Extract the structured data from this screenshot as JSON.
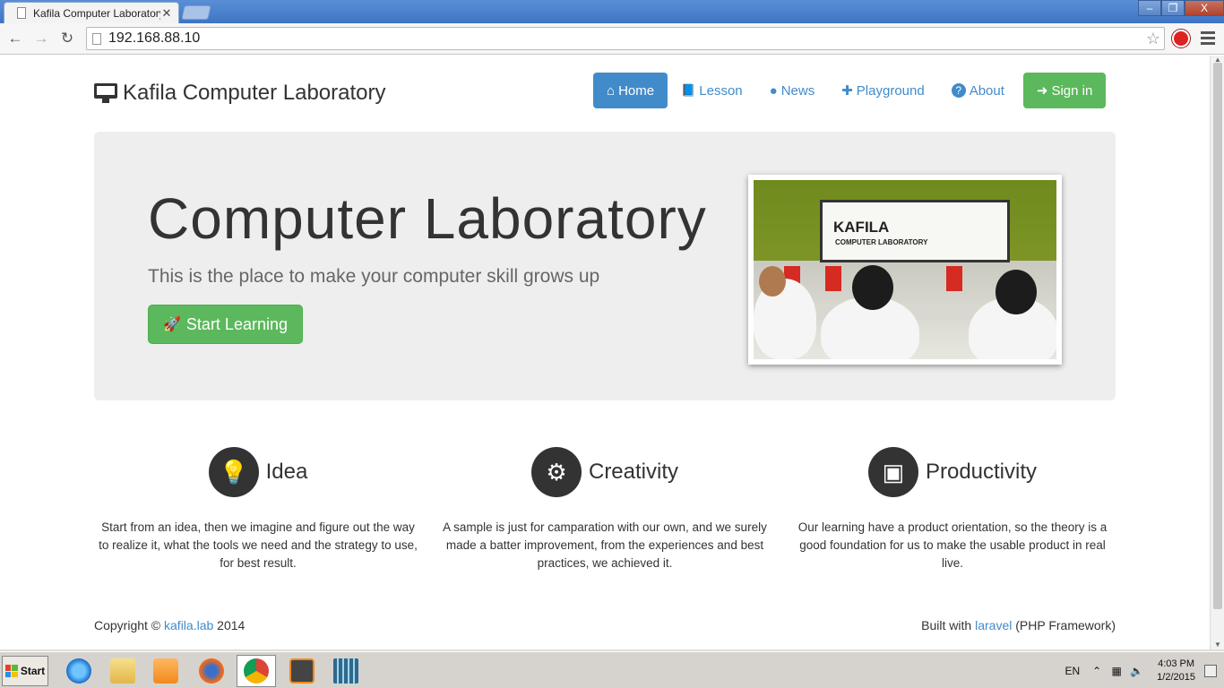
{
  "browser": {
    "tab_title": "Kafila Computer Laboratory",
    "tab_close": "✕",
    "url": "192.168.88.10",
    "window_controls": {
      "minimize": "–",
      "restore": "❐",
      "close": "X"
    }
  },
  "site": {
    "brand": "Kafila Computer Laboratory",
    "nav": [
      {
        "label": "Home",
        "icon": "home-icon",
        "glyph": "⌂"
      },
      {
        "label": "Lesson",
        "icon": "book-icon",
        "glyph": "📘"
      },
      {
        "label": "News",
        "icon": "globe-icon",
        "glyph": "●"
      },
      {
        "label": "Playground",
        "icon": "puzzle-icon",
        "glyph": "✚"
      },
      {
        "label": "About",
        "icon": "question-icon",
        "glyph": "?"
      },
      {
        "label": "Sign in",
        "icon": "sign-in-icon",
        "glyph": "➜"
      }
    ],
    "hero": {
      "title": "Computer Laboratory",
      "lead": "This is the place to make your computer skill grows up",
      "button": "Start Learning",
      "photo_text_1": "KAFILA",
      "photo_text_2": "COMPUTER LABORATORY"
    },
    "features": [
      {
        "title": "Idea",
        "icon": "lightbulb-icon",
        "glyph": "💡",
        "text": "Start from an idea, then we imagine and figure out the way to realize it, what the tools we need and the strategy to use, for best result."
      },
      {
        "title": "Creativity",
        "icon": "gears-icon",
        "glyph": "⚙",
        "text": "A sample is just for camparation with our own, and we surely made a batter improvement, from the experiences and best practices, we achieved it."
      },
      {
        "title": "Productivity",
        "icon": "cubes-icon",
        "glyph": "▣",
        "text": "Our learning have a product orientation, so the theory is a good foundation for us to make the usable product in real live."
      }
    ],
    "footer": {
      "copyright_prefix": "Copyright ©",
      "copyright_link": "kafila.lab",
      "copyright_year": "2014",
      "built_prefix": "Built with",
      "built_link": "laravel",
      "built_suffix": "(PHP Framework)"
    }
  },
  "taskbar": {
    "start": "Start",
    "language": "EN",
    "time": "4:03 PM",
    "date": "1/2/2015"
  }
}
